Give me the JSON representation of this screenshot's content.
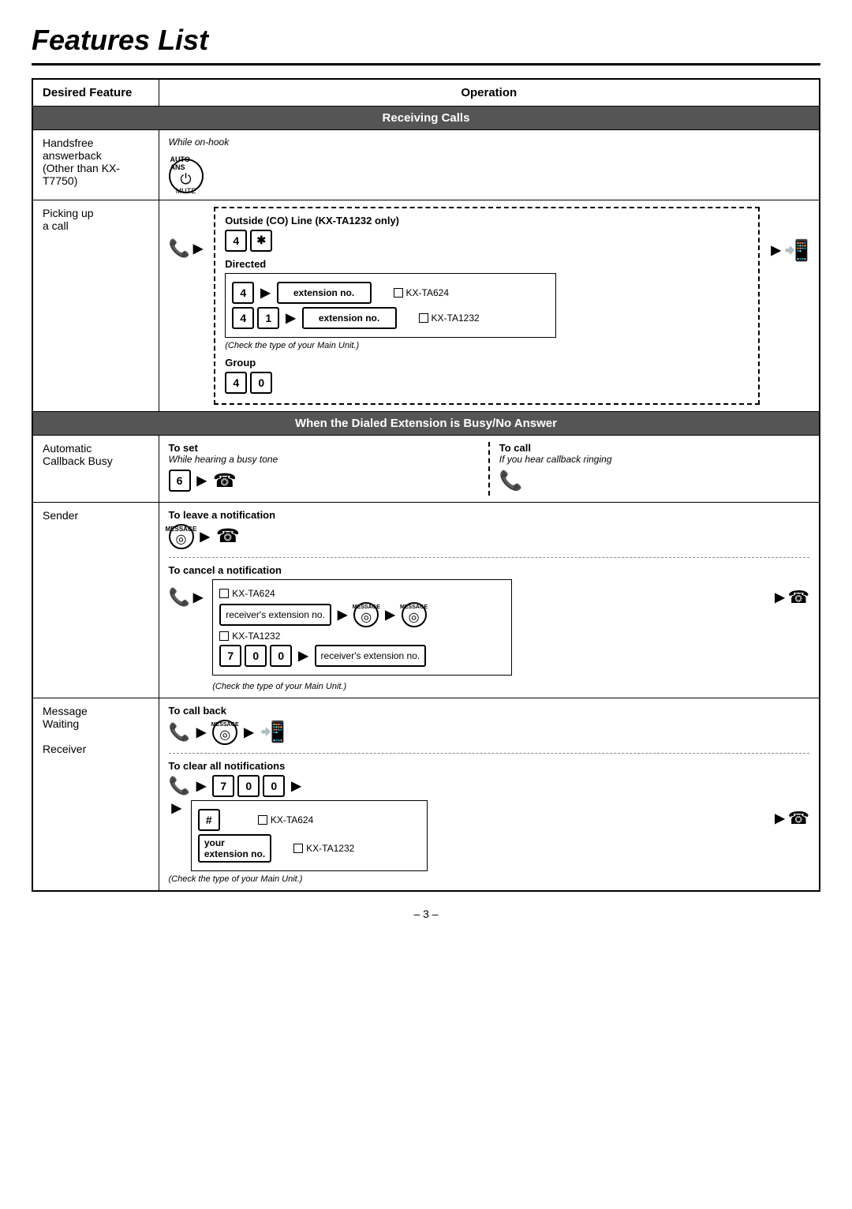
{
  "page": {
    "title": "Features List",
    "page_number": "– 3 –"
  },
  "table": {
    "header": {
      "desired_feature": "Desired Feature",
      "operation": "Operation"
    },
    "sections": [
      {
        "section_title": "Receiving Calls",
        "rows": [
          {
            "feature": "Handsfree answerback\n(Other than KX-T7750)",
            "operation_type": "handsfree"
          },
          {
            "feature": "Picking up\na call",
            "operation_type": "pickup"
          }
        ]
      },
      {
        "section_title": "When the Dialed Extension is Busy/No Answer",
        "rows": [
          {
            "feature": "Automatic Callback Busy",
            "operation_type": "callback_busy"
          },
          {
            "feature": "Message\nWaiting",
            "sub_rows": [
              "Sender",
              "Receiver"
            ],
            "operation_type": "message_waiting"
          }
        ]
      }
    ]
  },
  "labels": {
    "while_on_hook": "While on-hook",
    "auto_ans": "AUTO ANS",
    "mute": "MUTE",
    "outside_co_line": "Outside (CO) Line (KX-TA1232 only)",
    "directed": "Directed",
    "group": "Group",
    "check_type": "(Check the type of your Main Unit.)",
    "kx_ta624": "KX-TA624",
    "kx_ta1232": "KX-TA1232",
    "extension_no": "extension no.",
    "to_set": "To set",
    "to_call": "To call",
    "while_hearing_busy": "While hearing a busy tone",
    "if_you_hear_callback": "If you hear callback ringing",
    "to_leave_notification": "To leave a notification",
    "to_cancel_notification": "To cancel a notification",
    "message": "MESSAGE",
    "receivers_extension_no": "receiver's extension no.",
    "to_call_back": "To call back",
    "to_clear_all": "To clear all notifications",
    "your_extension_no": "your\nextension no.",
    "sender": "Sender",
    "receiver": "Receiver"
  }
}
